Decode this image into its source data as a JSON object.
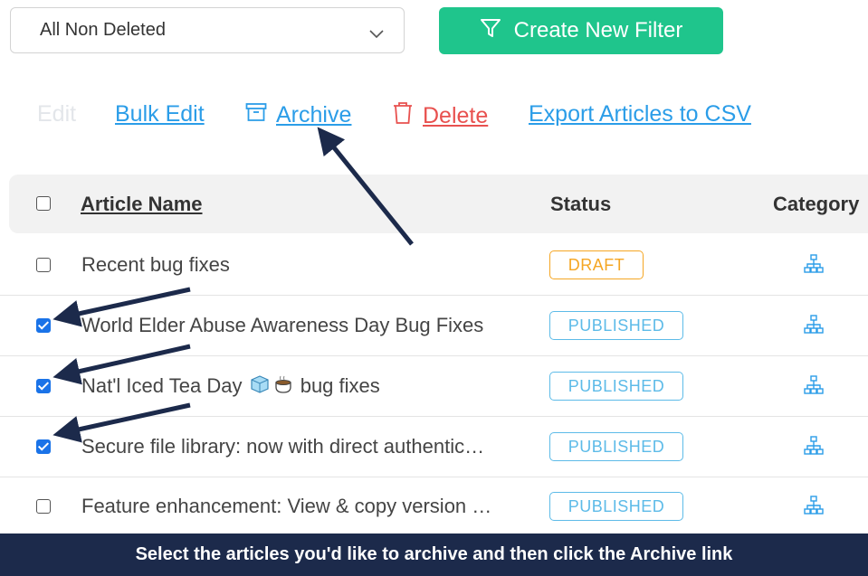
{
  "filter": {
    "selected": "All Non Deleted",
    "create_label": "Create New Filter"
  },
  "actions": {
    "edit": "Edit",
    "bulk_edit": "Bulk Edit",
    "archive": "Archive",
    "delete": "Delete",
    "export": "Export Articles to CSV"
  },
  "table": {
    "headers": {
      "name": "Article Name",
      "status": "Status",
      "category": "Category"
    },
    "rows": [
      {
        "name": "Recent bug fixes",
        "status": "DRAFT",
        "checked": false
      },
      {
        "name": "World Elder Abuse Awareness Day Bug Fixes",
        "status": "PUBLISHED",
        "checked": true
      },
      {
        "name_before": "Nat'l Iced Tea Day",
        "name_after": "bug fixes",
        "status": "PUBLISHED",
        "checked": true
      },
      {
        "name": "Secure file library: now with direct authentic…",
        "status": "PUBLISHED",
        "checked": true
      },
      {
        "name": "Feature enhancement: View & copy version …",
        "status": "PUBLISHED",
        "checked": false
      }
    ]
  },
  "banner": "Select the articles you'd like to archive and then click the Archive link",
  "colors": {
    "accent": "#1fc58c",
    "link": "#2b9de8",
    "danger": "#e8514f",
    "banner": "#1c2a4b",
    "arrow": "#1c2a4b"
  }
}
